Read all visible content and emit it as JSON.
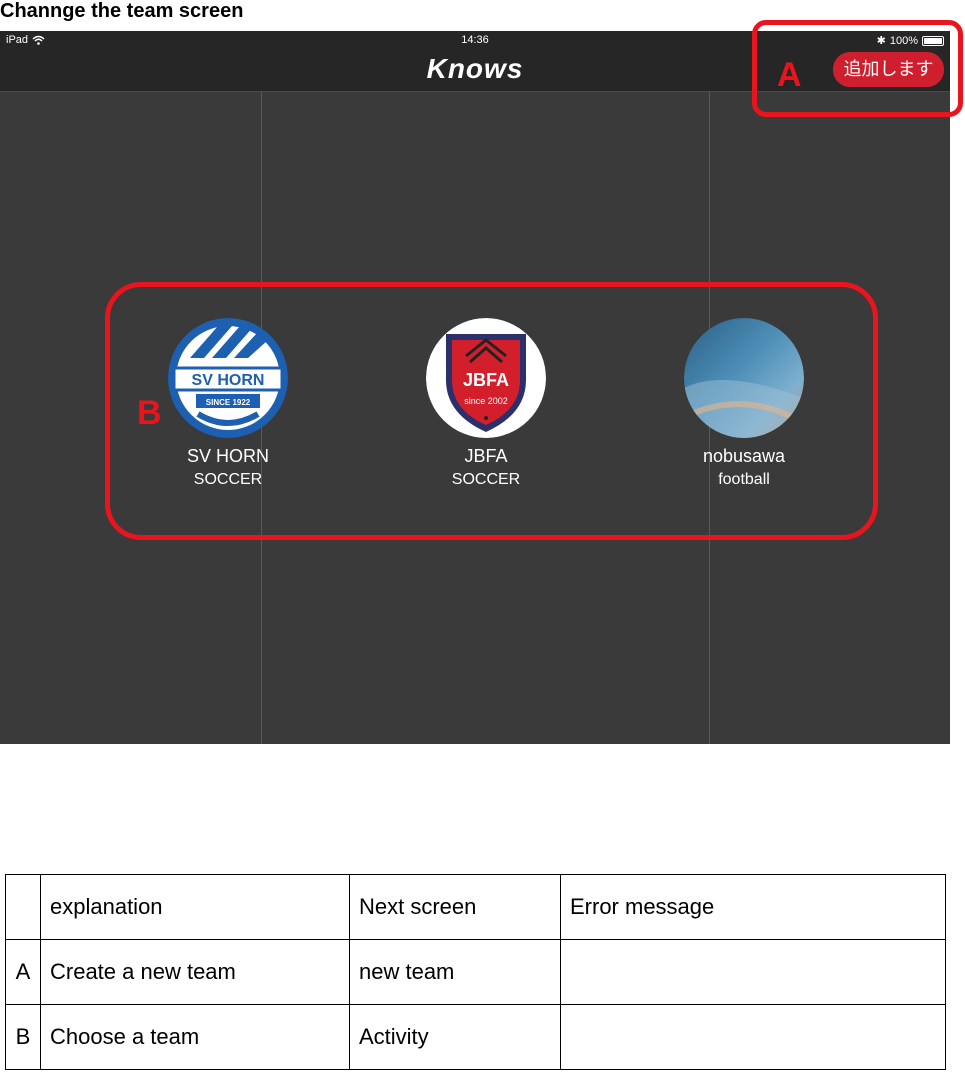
{
  "document": {
    "title": "Channge the team screen"
  },
  "ipad": {
    "status": {
      "device": "iPad",
      "time": "14:36",
      "battery": "100%"
    },
    "app_title": "Knows",
    "add_button": "追加します",
    "teams": [
      {
        "name": "SV HORN",
        "sport": "SOCCER",
        "logo_text": "SV HORN",
        "logo_subtext": "SINCE 1922"
      },
      {
        "name": "JBFA",
        "sport": "SOCCER",
        "logo_text": "JBFA",
        "logo_subtext": "since 2002"
      },
      {
        "name": "nobusawa",
        "sport": "football"
      }
    ]
  },
  "annotations": {
    "a": "A",
    "b": "B"
  },
  "table": {
    "headers": [
      "",
      "explanation",
      "Next screen",
      "Error message"
    ],
    "rows": [
      [
        "A",
        "Create a new team",
        "new team",
        ""
      ],
      [
        "B",
        "Choose a team",
        "Activity",
        ""
      ]
    ]
  },
  "colors": {
    "annotation_red": "#e8141e",
    "button_red": "#cf1f2e",
    "screen_bg": "#3a3a3a",
    "navbar_bg": "#262626"
  }
}
